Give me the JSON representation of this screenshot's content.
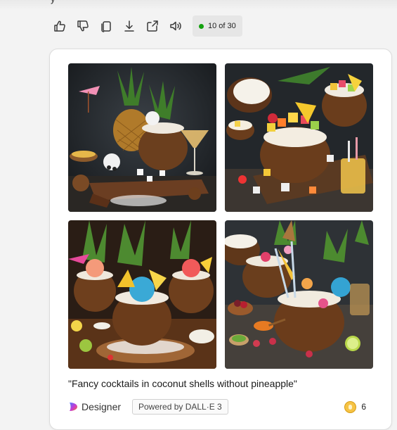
{
  "toolbar": {
    "buttons": [
      {
        "icon": "thumbs-up-icon"
      },
      {
        "icon": "thumbs-down-icon"
      },
      {
        "icon": "copy-icon"
      },
      {
        "icon": "download-icon"
      },
      {
        "icon": "share-icon"
      },
      {
        "icon": "speaker-icon"
      }
    ],
    "counter_text": "10 of 30",
    "counter_dot_color": "#13a10e"
  },
  "card": {
    "images": [
      {
        "subject": "coconut cocktails with pineapple crowns on dark wooden board"
      },
      {
        "subject": "halved coconuts filled with cubed fruit salad"
      },
      {
        "subject": "coconut cocktails with sorbet scoops and pineapple wedges"
      },
      {
        "subject": "coconut shells with flowers, straws and berries"
      }
    ],
    "prompt": "\"Fancy cocktails in coconut shells without pineapple\"",
    "footer": {
      "brand": "Designer",
      "powered_by": "Powered by DALL·E 3",
      "coin_count": "6"
    }
  }
}
